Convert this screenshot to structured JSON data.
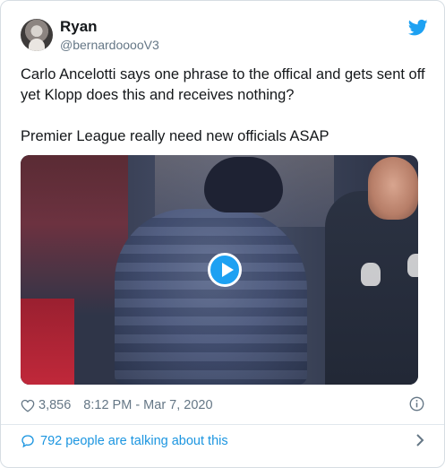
{
  "user": {
    "name": "Ryan",
    "handle": "@bernardooooV3",
    "avatar_icon": "profile-photo"
  },
  "tweet": {
    "lines": [
      "Carlo Ancelotti says one phrase to the offical and gets sent off yet Klopp does this and receives nothing?",
      "Premier League really need new officials ASAP"
    ]
  },
  "media": {
    "type": "video",
    "play_icon": "play-icon"
  },
  "meta": {
    "likes": "3,856",
    "timestamp": "8:12 PM - Mar 7, 2020",
    "heart_icon": "heart-icon",
    "info_icon": "info-icon"
  },
  "footer": {
    "conversation": "792 people are talking about this",
    "bubble_icon": "speech-bubble-icon",
    "chevron_icon": "chevron-right-icon"
  },
  "colors": {
    "brand_blue": "#1da1f2",
    "link_blue": "#1b95e0",
    "secondary_text": "#657786",
    "primary_text": "#14171a",
    "border": "#d6dde3"
  }
}
